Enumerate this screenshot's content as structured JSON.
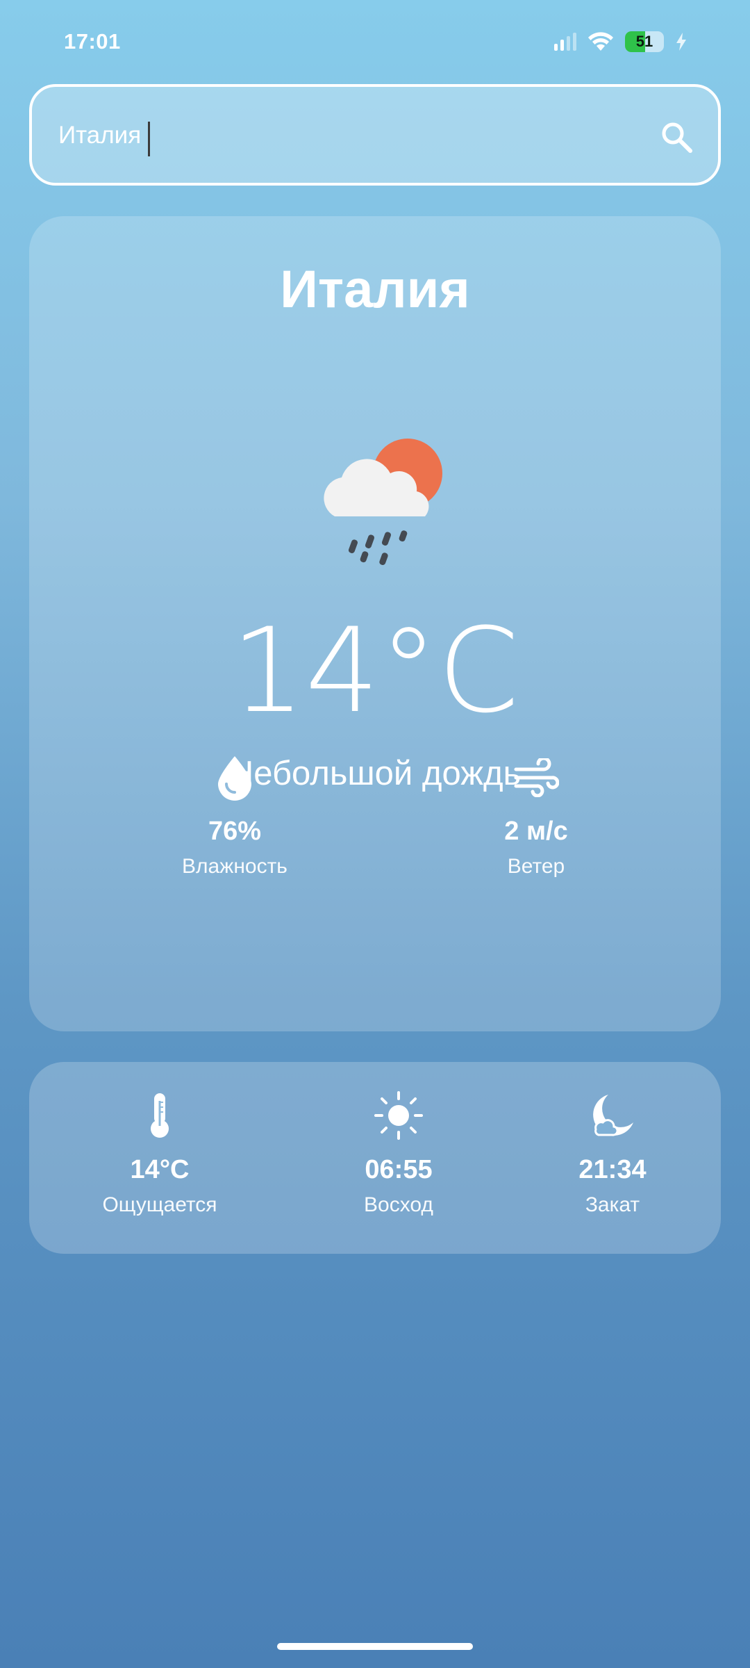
{
  "status_bar": {
    "time": "17:01",
    "battery_level": "51",
    "battery_fraction": 0.51,
    "battery_color": "#2fc24a",
    "icons": [
      "signal-icon",
      "wifi-icon",
      "battery-icon",
      "charging-bolt-icon"
    ]
  },
  "search": {
    "value": "Италия",
    "icon": "search-icon"
  },
  "current": {
    "city": "Италия",
    "temperature": "14°C",
    "description": "Небольшой дождь",
    "icon": "rain-cloud-sun-icon",
    "sun_color": "#ec724d",
    "humidity": {
      "value": "76%",
      "label": "Влажность",
      "icon": "water-drop-icon"
    },
    "wind": {
      "value": "2 м/с",
      "label": "Ветер",
      "icon": "wind-icon"
    }
  },
  "details": {
    "feels_like": {
      "value": "14°C",
      "label": "Ощущается",
      "icon": "thermometer-icon"
    },
    "sunrise": {
      "value": "06:55",
      "label": "Восход",
      "icon": "sun-icon"
    },
    "sunset": {
      "value": "21:34",
      "label": "Закат",
      "icon": "moon-icon"
    }
  }
}
